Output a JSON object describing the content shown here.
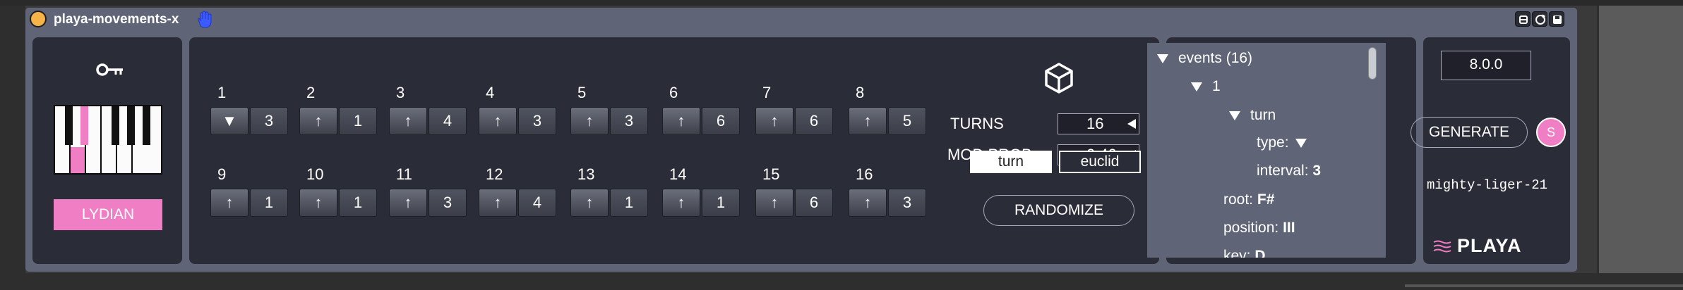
{
  "device": {
    "title": "playa-movements-x",
    "accent": "#f07ec4",
    "power_color": "#f5b348"
  },
  "key_panel": {
    "icon": "key-icon",
    "scale": "LYDIAN",
    "highlighted_key": "F#"
  },
  "steps": [
    {
      "num": "1",
      "dir": "▼",
      "val": "3"
    },
    {
      "num": "2",
      "dir": "↑",
      "val": "1"
    },
    {
      "num": "3",
      "dir": "↑",
      "val": "4"
    },
    {
      "num": "4",
      "dir": "↑",
      "val": "3"
    },
    {
      "num": "5",
      "dir": "↑",
      "val": "3"
    },
    {
      "num": "6",
      "dir": "↑",
      "val": "6"
    },
    {
      "num": "7",
      "dir": "↑",
      "val": "6"
    },
    {
      "num": "8",
      "dir": "↑",
      "val": "5"
    },
    {
      "num": "9",
      "dir": "↑",
      "val": "1"
    },
    {
      "num": "10",
      "dir": "↑",
      "val": "1"
    },
    {
      "num": "11",
      "dir": "↑",
      "val": "3"
    },
    {
      "num": "12",
      "dir": "↑",
      "val": "4"
    },
    {
      "num": "13",
      "dir": "↑",
      "val": "1"
    },
    {
      "num": "14",
      "dir": "↑",
      "val": "1"
    },
    {
      "num": "15",
      "dir": "↑",
      "val": "6"
    },
    {
      "num": "16",
      "dir": "↑",
      "val": "3"
    }
  ],
  "params": {
    "turns_label": "TURNS",
    "turns_value": "16",
    "modprob_label": "MOD PROB",
    "modprob_value": "0.40",
    "mode_turn": "turn",
    "mode_euclid": "euclid",
    "randomize": "RANDOMIZE"
  },
  "events": {
    "root_label": "events (16)",
    "item_label": "1",
    "turn_label": "turn",
    "type_label": "type:",
    "interval_label": "interval:",
    "interval_value": "3",
    "root_key": "root:",
    "root_value": "F#",
    "position_key": "position:",
    "position_value": "III",
    "key_key": "key:",
    "key_value": "D"
  },
  "generate_panel": {
    "version": "8.0.0",
    "generate": "GENERATE",
    "badge": "S",
    "seed": "mighty-liger-21",
    "logo": "PLAYA"
  }
}
